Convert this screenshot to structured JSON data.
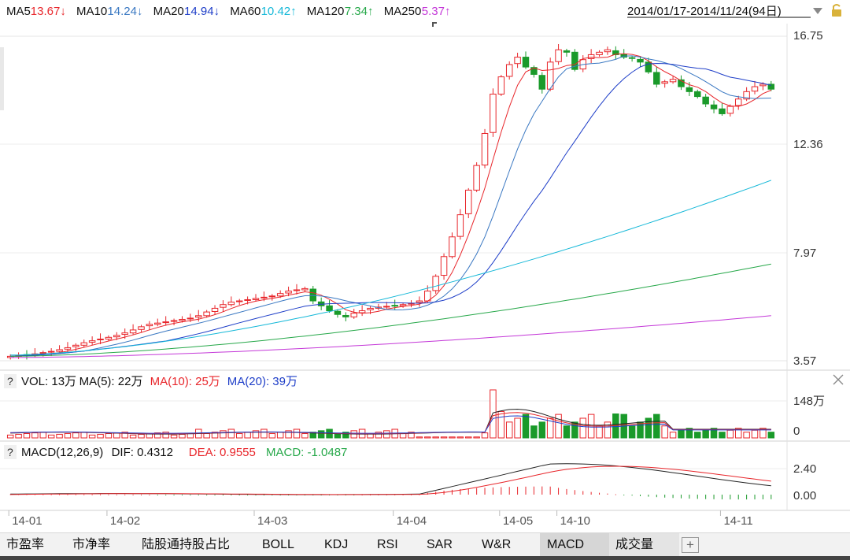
{
  "price_legend": {
    "items": [
      {
        "label": "MA5",
        "value": "13.67↓",
        "color": "#e8262b"
      },
      {
        "label": "MA10",
        "value": "14.24↓",
        "color": "#3a78c2"
      },
      {
        "label": "MA20",
        "value": "14.94↓",
        "color": "#1e3ec8"
      },
      {
        "label": "MA60",
        "value": "10.42↑",
        "color": "#15b8d8"
      },
      {
        "label": "MA120",
        "value": "7.34↑",
        "color": "#27a84a"
      },
      {
        "label": "MA250",
        "value": "5.37↑",
        "color": "#c438d8"
      }
    ],
    "date_range": "2014/01/17-2014/11/24(94日)"
  },
  "price_axis": [
    "16.75",
    "12.36",
    "7.97",
    "3.57"
  ],
  "vol_legend": {
    "help": "?",
    "items": [
      {
        "text": "VOL: 13万",
        "color": "#111111"
      },
      {
        "text": "MA(5): 22万",
        "color": "#111111"
      },
      {
        "text": "MA(10): 25万",
        "color": "#e8262b"
      },
      {
        "text": "MA(20): 39万",
        "color": "#1e3ec8"
      }
    ]
  },
  "vol_axis": [
    "148万",
    "0"
  ],
  "macd_legend": {
    "help": "?",
    "items": [
      {
        "text": "MACD(12,26,9)",
        "color": "#111111"
      },
      {
        "text": "DIF: 0.4312",
        "color": "#111111"
      },
      {
        "text": "DEA: 0.9555",
        "color": "#e8262b"
      },
      {
        "text": "MACD: -1.0487",
        "color": "#27a84a"
      }
    ]
  },
  "macd_axis": [
    "2.40",
    "0.00"
  ],
  "x_axis_labels": [
    "14-01",
    "14-02",
    "14-03",
    "14-04",
    "14-05",
    "14-10",
    "14-11"
  ],
  "colors": {
    "up": "#e8262b",
    "down": "#1a9a2a",
    "grid": "#e6e6e6"
  },
  "tabs": [
    {
      "label": "市盈率",
      "active": false
    },
    {
      "label": "市净率",
      "active": false
    },
    {
      "label": "陆股通持股占比",
      "active": false
    },
    {
      "label": "BOLL",
      "active": false
    },
    {
      "label": "KDJ",
      "active": false
    },
    {
      "label": "RSI",
      "active": false
    },
    {
      "label": "SAR",
      "active": false
    },
    {
      "label": "W&R",
      "active": false
    },
    {
      "label": "MACD",
      "active": true
    },
    {
      "label": "成交量",
      "active": false
    }
  ],
  "chart_data": {
    "type": "candlestick",
    "candles_count": 94,
    "price_range": [
      3.57,
      16.75
    ],
    "closes": [
      3.75,
      3.78,
      3.8,
      3.85,
      3.9,
      3.95,
      4.02,
      4.1,
      4.2,
      4.3,
      4.38,
      4.45,
      4.52,
      4.6,
      4.7,
      4.82,
      4.95,
      5.05,
      5.1,
      5.15,
      5.2,
      5.25,
      5.3,
      5.4,
      5.55,
      5.7,
      5.85,
      5.95,
      6.0,
      6.05,
      6.1,
      6.15,
      6.2,
      6.3,
      6.4,
      6.45,
      6.5,
      6.0,
      5.8,
      5.6,
      5.45,
      5.35,
      5.5,
      5.6,
      5.7,
      5.75,
      5.78,
      5.8,
      5.85,
      5.9,
      6.0,
      6.4,
      7.0,
      7.8,
      8.6,
      9.5,
      10.5,
      11.5,
      12.8,
      14.4,
      15.1,
      15.6,
      15.9,
      15.5,
      15.2,
      14.6,
      15.7,
      16.2,
      16.1,
      15.4,
      15.8,
      16.0,
      16.1,
      16.2,
      16.0,
      15.9,
      15.85,
      15.7,
      15.3,
      14.8,
      14.9,
      15.0,
      14.7,
      14.5,
      14.3,
      14.0,
      13.8,
      13.6,
      13.9,
      14.2,
      14.5,
      14.7,
      14.8,
      14.6
    ]
  }
}
